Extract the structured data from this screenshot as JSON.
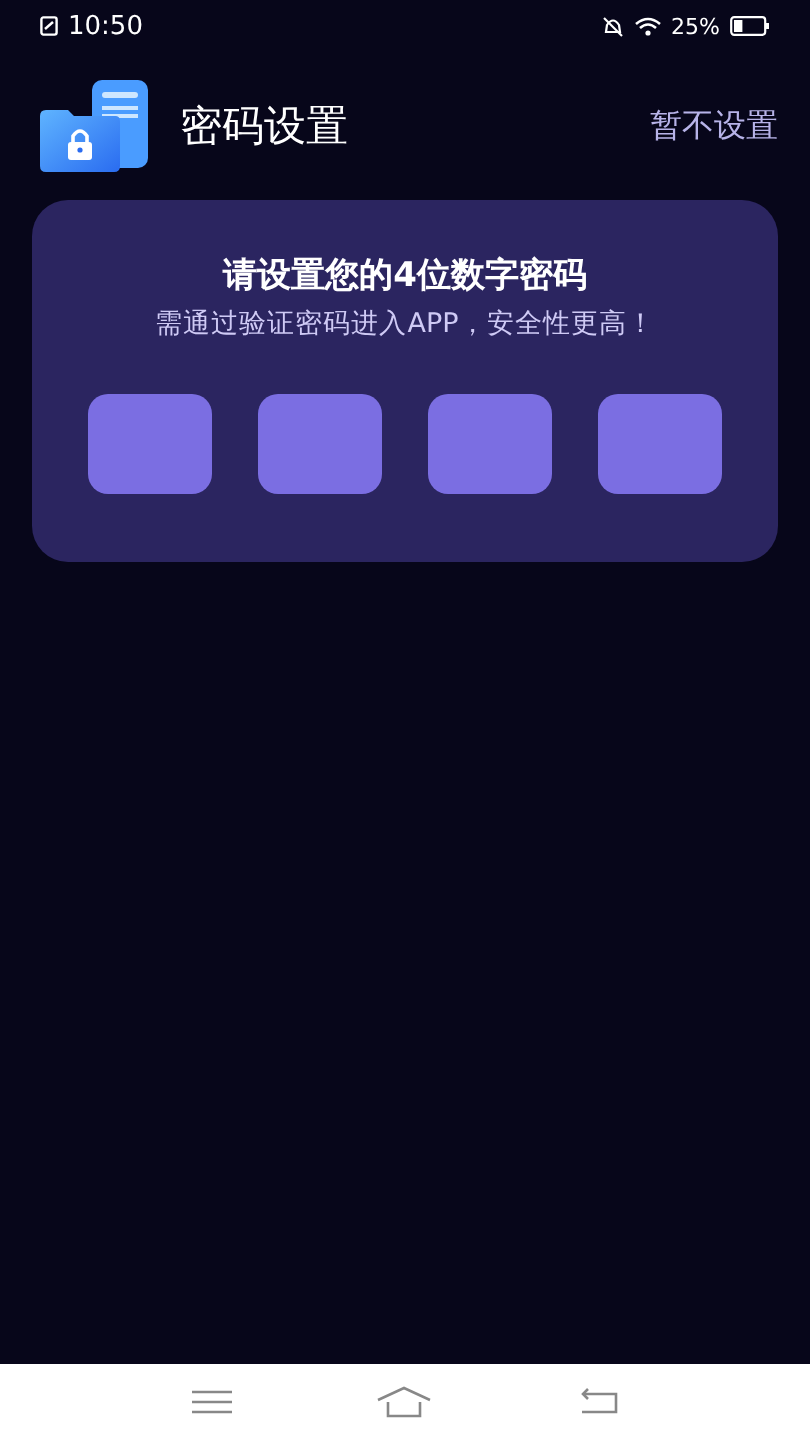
{
  "status_bar": {
    "time": "10:50",
    "battery": "25%"
  },
  "header": {
    "title": "密码设置",
    "skip": "暂不设置"
  },
  "card": {
    "heading": "请设置您的4位数字密码",
    "hint": "需通过验证密码进入APP，安全性更高！",
    "pin_slots": [
      {
        "kind": "empty"
      },
      {
        "kind": "empty"
      },
      {
        "kind": "empty"
      },
      {
        "kind": "empty"
      }
    ]
  }
}
